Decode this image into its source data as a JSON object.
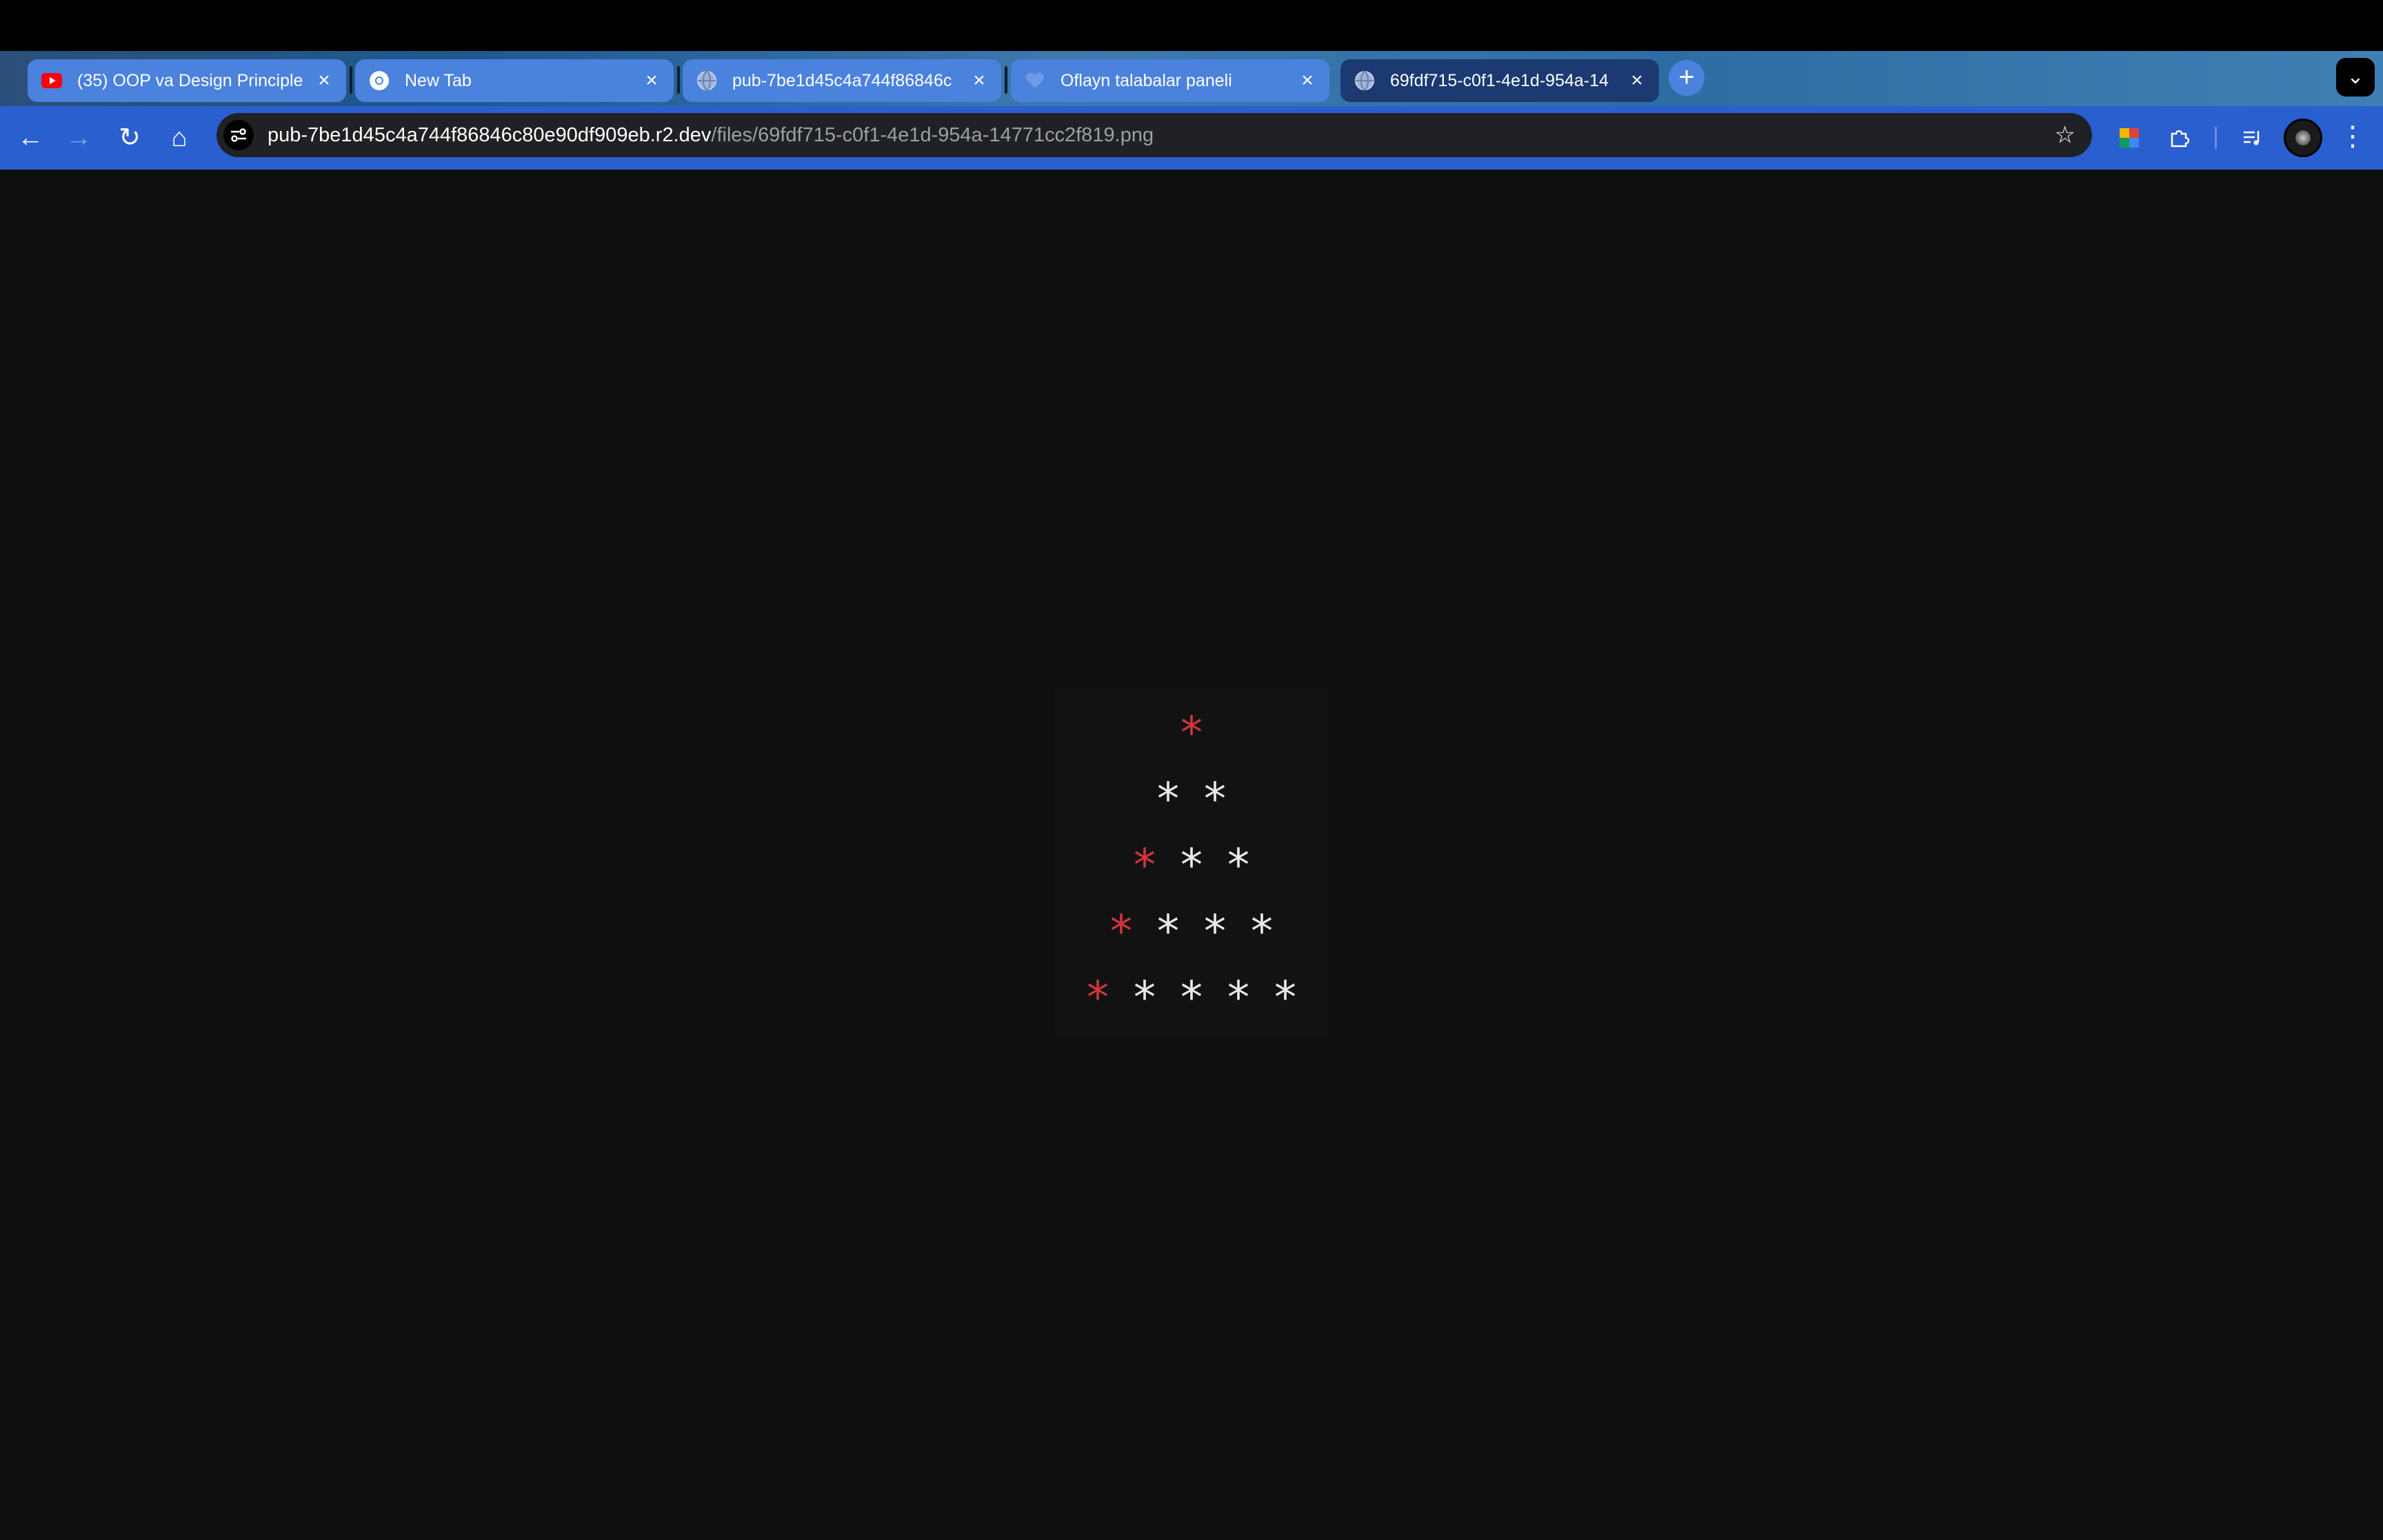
{
  "browser": {
    "tabs": [
      {
        "title": "(35) OOP va Design Principle",
        "favicon": "youtube-icon",
        "active": false
      },
      {
        "title": "New Tab",
        "favicon": "chrome-icon",
        "active": false
      },
      {
        "title": "pub-7be1d45c4a744f86846c",
        "favicon": "globe-icon",
        "active": false
      },
      {
        "title": "Oflayn talabalar paneli",
        "favicon": "heart-icon",
        "active": false
      },
      {
        "title": "69fdf715-c0f1-4e1d-954a-14",
        "favicon": "globe-icon",
        "active": true
      }
    ],
    "new_tab_label": "+",
    "tab_search_label": "⌄",
    "close_label": "×",
    "omnibox": {
      "host": "pub-7be1d45c4a744f86846c80e90df909eb.r2.dev",
      "path": "/files/69fdf715-c0f1-4e1d-954a-14771cc2f819.png"
    },
    "nav": {
      "back": "←",
      "forward": "→",
      "reload": "↻",
      "home": "⌂"
    },
    "star_label": "☆",
    "kebab_label": "⋮"
  },
  "content": {
    "rows": [
      [
        {
          "char": "*",
          "color": "#d2353d"
        }
      ],
      [
        {
          "char": "*",
          "color": "#e8e8e8"
        },
        {
          "char": "*",
          "color": "#e8e8e8"
        }
      ],
      [
        {
          "char": "*",
          "color": "#d2353d"
        },
        {
          "char": "*",
          "color": "#e8e8e8"
        },
        {
          "char": "*",
          "color": "#e8e8e8"
        }
      ],
      [
        {
          "char": "*",
          "color": "#d2353d"
        },
        {
          "char": "*",
          "color": "#e8e8e8"
        },
        {
          "char": "*",
          "color": "#e8e8e8"
        },
        {
          "char": "*",
          "color": "#e8e8e8"
        }
      ],
      [
        {
          "char": "*",
          "color": "#d2353d"
        },
        {
          "char": "*",
          "color": "#e8e8e8"
        },
        {
          "char": "*",
          "color": "#e8e8e8"
        },
        {
          "char": "*",
          "color": "#e8e8e8"
        },
        {
          "char": "*",
          "color": "#e8e8e8"
        }
      ]
    ]
  }
}
